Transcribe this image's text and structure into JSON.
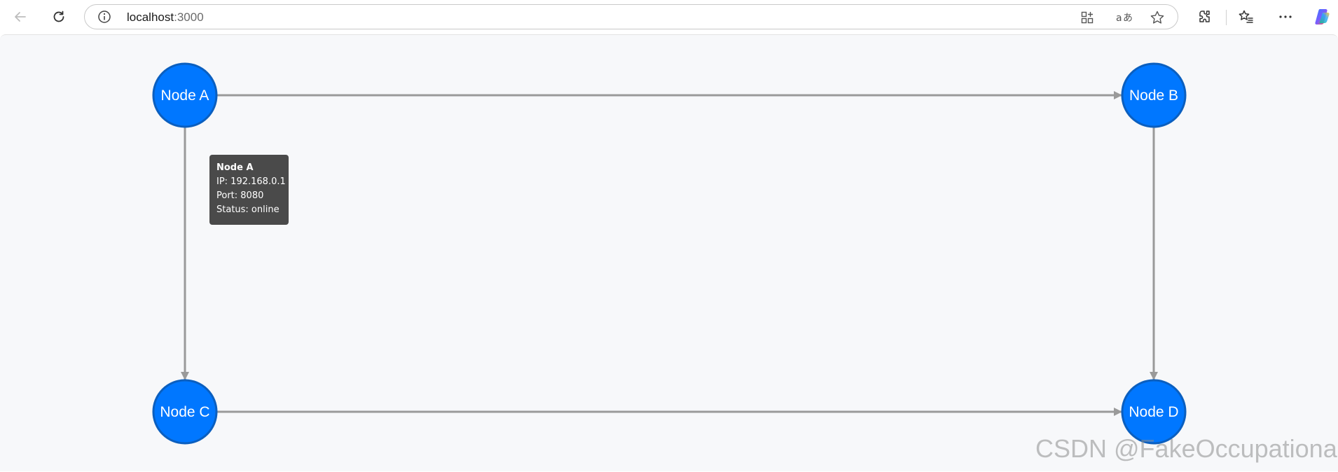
{
  "browser": {
    "url_host": "localhost",
    "url_port": ":3000"
  },
  "graph": {
    "nodes": [
      {
        "id": "A",
        "label": "Node A"
      },
      {
        "id": "B",
        "label": "Node B"
      },
      {
        "id": "C",
        "label": "Node C"
      },
      {
        "id": "D",
        "label": "Node D"
      }
    ],
    "edges": [
      {
        "from": "A",
        "to": "B"
      },
      {
        "from": "A",
        "to": "C"
      },
      {
        "from": "B",
        "to": "D"
      },
      {
        "from": "C",
        "to": "D"
      }
    ],
    "colors": {
      "node_fill": "#0077ff",
      "node_stroke": "#0b5fbf",
      "edge": "#9a9a9a",
      "canvas_bg": "#f7f8fa",
      "tooltip_bg": "#4a4a4a"
    }
  },
  "tooltip": {
    "title": "Node A",
    "ip": "IP: 192.168.0.1",
    "port": "Port: 8080",
    "status": "Status: online"
  },
  "watermark": "CSDN @FakeOccupational",
  "icons": {
    "back": "back-arrow-icon",
    "reload": "reload-icon",
    "info": "info-icon",
    "apps": "apps-icon",
    "read_aloud": "read-aloud-icon",
    "favorite": "star-icon",
    "extensions": "extensions-icon",
    "favorites": "favorites-icon",
    "more": "more-icon",
    "copilot": "copilot-icon"
  }
}
